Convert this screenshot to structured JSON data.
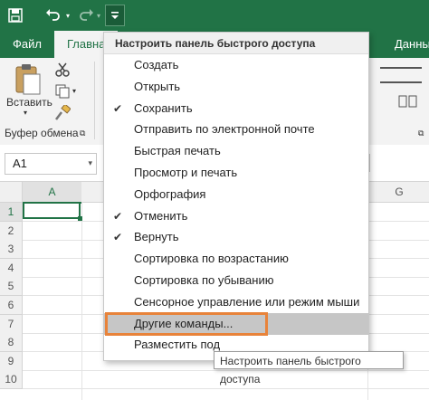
{
  "qat": {
    "save_icon": "save-icon",
    "undo_icon": "undo-icon",
    "redo_icon": "redo-icon",
    "customize_icon": "customize-qat-icon"
  },
  "tabs": [
    {
      "label": "Файл"
    },
    {
      "label": "Главная"
    },
    {
      "label": "Данны"
    }
  ],
  "ribbon": {
    "paste_label": "Вставить",
    "clipboard_group": "Буфер обмена",
    "colors": {
      "accent": "#217346"
    }
  },
  "namebox": {
    "value": "A1"
  },
  "columns": [
    "A",
    "G"
  ],
  "rows": [
    "1",
    "2",
    "3",
    "4",
    "5",
    "6",
    "7",
    "8",
    "9",
    "10"
  ],
  "menu": {
    "title": "Настроить панель быстрого доступа",
    "items": [
      {
        "label": "Создать",
        "checked": false
      },
      {
        "label": "Открыть",
        "checked": false
      },
      {
        "label": "Сохранить",
        "checked": true
      },
      {
        "label": "Отправить по электронной почте",
        "checked": false
      },
      {
        "label": "Быстрая печать",
        "checked": false
      },
      {
        "label": "Просмотр и печать",
        "checked": false
      },
      {
        "label": "Орфография",
        "checked": false
      },
      {
        "label": "Отменить",
        "checked": true
      },
      {
        "label": "Вернуть",
        "checked": true
      },
      {
        "label": "Сортировка по возрастанию",
        "checked": false
      },
      {
        "label": "Сортировка по убыванию",
        "checked": false
      },
      {
        "label": "Сенсорное управление или режим мыши",
        "checked": false
      },
      {
        "label": "Другие команды...",
        "checked": false
      },
      {
        "label": "Разместить под",
        "checked": false
      }
    ],
    "check_glyph": "✔"
  },
  "tooltip": {
    "text": "Настроить панель быстрого доступа"
  }
}
